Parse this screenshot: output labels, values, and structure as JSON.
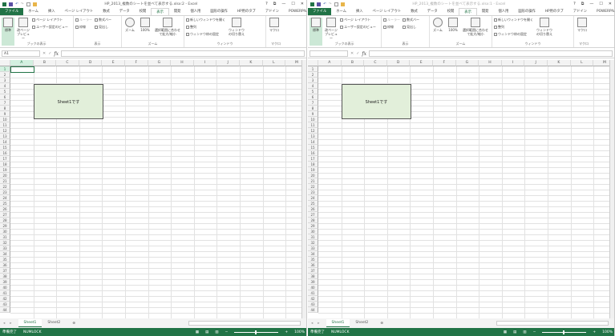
{
  "windows": [
    {
      "title": "HP_2013_複数のシートを並べて表示する.xlsx:2 - Excel",
      "name_box": "A1",
      "active": true
    },
    {
      "title": "HP_2013_複数のシートを並べて表示する.xlsx:1 - Excel",
      "name_box": "",
      "active": false
    }
  ],
  "window_controls": [
    "?",
    "⧉",
    "—",
    "☐",
    "✕"
  ],
  "tabs": [
    "ファイル",
    "ホーム",
    "挿入",
    "ページ レイアウト",
    "数式",
    "データ",
    "校閲",
    "表示",
    "開発",
    "個人用",
    "図形の操作",
    "HP用のタブ",
    "アドイン",
    "POWERPIVOT"
  ],
  "active_tab": "表示",
  "ribbon": {
    "book_view": {
      "label": "ブックの表示",
      "normal": "標準",
      "page_break": "改ページ プレビュー",
      "page_layout": "ページ レイアウト",
      "custom_view": "ユーザー設定のビュー"
    },
    "show": {
      "label": "表示",
      "ruler": "ルーラー",
      "formula_bar": "数式バー",
      "gridlines": "枠線",
      "headings": "見出し"
    },
    "zoom": {
      "label": "ズーム",
      "zoom": "ズーム",
      "hundred": "100%",
      "fit": "選択範囲に合わせて拡大/縮小"
    },
    "window": {
      "label": "ウィンドウ",
      "new_window": "新しいウィンドウを開く",
      "arrange": "整列",
      "freeze": "ウィンドウ枠の固定",
      "switch": "ウィンドウの切り替え"
    },
    "macro": {
      "label": "マクロ",
      "macro": "マクロ"
    }
  },
  "formula_bar": {
    "fx": "fx",
    "cancel": "✕",
    "enter": "✓"
  },
  "columns": [
    "A",
    "B",
    "C",
    "D",
    "E",
    "F",
    "G",
    "H",
    "I",
    "J",
    "K",
    "L",
    "M"
  ],
  "row_count": 44,
  "textbox": "Sheet1です",
  "sheets": [
    "Sheet1",
    "Sheet2"
  ],
  "active_sheet": "Sheet1",
  "status": {
    "ready": "準備完了",
    "numlock": "NUMLOCK",
    "zoom": "100%"
  }
}
